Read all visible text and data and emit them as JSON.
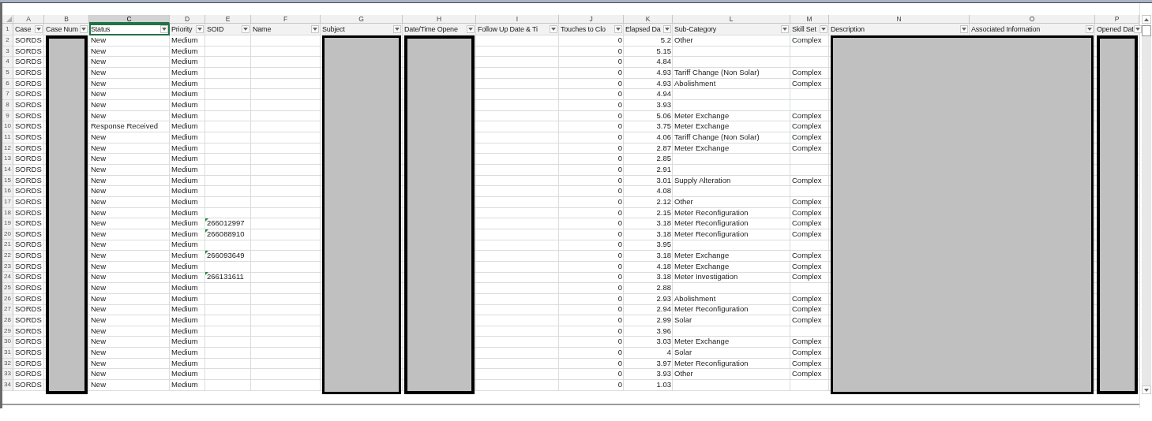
{
  "header_row_number": "1",
  "columns": [
    {
      "letter": "A",
      "header": "Case",
      "selected": false,
      "redacted": false
    },
    {
      "letter": "B",
      "header": "Case Num",
      "selected": false,
      "redacted": true
    },
    {
      "letter": "C",
      "header": "Status",
      "selected": true,
      "redacted": false
    },
    {
      "letter": "D",
      "header": "Priority",
      "selected": false,
      "redacted": false
    },
    {
      "letter": "E",
      "header": "SOID",
      "selected": false,
      "redacted": false
    },
    {
      "letter": "F",
      "header": "Name",
      "selected": false,
      "redacted": false
    },
    {
      "letter": "G",
      "header": "Subject",
      "selected": false,
      "redacted": true
    },
    {
      "letter": "H",
      "header": "Date/Time Opene",
      "selected": false,
      "redacted": true
    },
    {
      "letter": "I",
      "header": "Follow Up Date & Ti",
      "selected": false,
      "redacted": false
    },
    {
      "letter": "J",
      "header": "Touches to Clo",
      "selected": false,
      "redacted": false
    },
    {
      "letter": "K",
      "header": "Elapsed Da",
      "selected": false,
      "redacted": false
    },
    {
      "letter": "L",
      "header": "Sub-Category",
      "selected": false,
      "redacted": false
    },
    {
      "letter": "M",
      "header": "Skill Set",
      "selected": false,
      "redacted": false
    },
    {
      "letter": "N",
      "header": "Description",
      "selected": false,
      "redacted": true,
      "merged_with_next": true
    },
    {
      "letter": "O",
      "header": "Associated Information",
      "selected": false,
      "redacted": true
    },
    {
      "letter": "P",
      "header": "Opened Dat",
      "selected": false,
      "redacted": true
    }
  ],
  "rows": [
    {
      "number": "2",
      "case": "SORDS",
      "status": "New",
      "priority": "Medium",
      "soid_flag": false,
      "touches": "0",
      "elapsed": "5.2",
      "sub_category": "Other",
      "skill_set": "Complex"
    },
    {
      "number": "3",
      "case": "SORDS",
      "status": "New",
      "priority": "Medium",
      "soid_flag": false,
      "touches": "0",
      "elapsed": "5.15"
    },
    {
      "number": "4",
      "case": "SORDS",
      "status": "New",
      "priority": "Medium",
      "soid_flag": false,
      "touches": "0",
      "elapsed": "4.84"
    },
    {
      "number": "5",
      "case": "SORDS",
      "status": "New",
      "priority": "Medium",
      "soid_flag": false,
      "touches": "0",
      "elapsed": "4.93",
      "sub_category": "Tariff Change (Non Solar)",
      "skill_set": "Complex"
    },
    {
      "number": "6",
      "case": "SORDS",
      "status": "New",
      "priority": "Medium",
      "soid_flag": false,
      "touches": "0",
      "elapsed": "4.93",
      "sub_category": "Abolishment",
      "skill_set": "Complex"
    },
    {
      "number": "7",
      "case": "SORDS",
      "status": "New",
      "priority": "Medium",
      "soid_flag": false,
      "touches": "0",
      "elapsed": "4.94"
    },
    {
      "number": "8",
      "case": "SORDS",
      "status": "New",
      "priority": "Medium",
      "soid_flag": false,
      "touches": "0",
      "elapsed": "3.93"
    },
    {
      "number": "9",
      "case": "SORDS",
      "status": "New",
      "priority": "Medium",
      "soid_flag": false,
      "touches": "0",
      "elapsed": "5.06",
      "sub_category": "Meter Exchange",
      "skill_set": "Complex"
    },
    {
      "number": "10",
      "case": "SORDS",
      "status": "Response Received",
      "priority": "Medium",
      "soid_flag": false,
      "touches": "0",
      "elapsed": "3.75",
      "sub_category": "Meter Exchange",
      "skill_set": "Complex"
    },
    {
      "number": "11",
      "case": "SORDS",
      "status": "New",
      "priority": "Medium",
      "soid_flag": false,
      "touches": "0",
      "elapsed": "4.06",
      "sub_category": "Tariff Change (Non Solar)",
      "skill_set": "Complex"
    },
    {
      "number": "12",
      "case": "SORDS",
      "status": "New",
      "priority": "Medium",
      "soid_flag": false,
      "touches": "0",
      "elapsed": "2.87",
      "sub_category": "Meter Exchange",
      "skill_set": "Complex"
    },
    {
      "number": "13",
      "case": "SORDS",
      "status": "New",
      "priority": "Medium",
      "soid_flag": false,
      "touches": "0",
      "elapsed": "2.85"
    },
    {
      "number": "14",
      "case": "SORDS",
      "status": "New",
      "priority": "Medium",
      "soid_flag": false,
      "touches": "0",
      "elapsed": "2.91"
    },
    {
      "number": "15",
      "case": "SORDS",
      "status": "New",
      "priority": "Medium",
      "soid_flag": false,
      "touches": "0",
      "elapsed": "3.01",
      "sub_category": "Supply Alteration",
      "skill_set": "Complex"
    },
    {
      "number": "16",
      "case": "SORDS",
      "status": "New",
      "priority": "Medium",
      "soid_flag": false,
      "touches": "0",
      "elapsed": "4.08"
    },
    {
      "number": "17",
      "case": "SORDS",
      "status": "New",
      "priority": "Medium",
      "soid_flag": false,
      "touches": "0",
      "elapsed": "2.12",
      "sub_category": "Other",
      "skill_set": "Complex"
    },
    {
      "number": "18",
      "case": "SORDS",
      "status": "New",
      "priority": "Medium",
      "soid_flag": false,
      "touches": "0",
      "elapsed": "2.15",
      "sub_category": "Meter Reconfiguration",
      "skill_set": "Complex"
    },
    {
      "number": "19",
      "case": "SORDS",
      "status": "New",
      "priority": "Medium",
      "soid": "266012997",
      "soid_flag": true,
      "touches": "0",
      "elapsed": "3.18",
      "sub_category": "Meter Reconfiguration",
      "skill_set": "Complex"
    },
    {
      "number": "20",
      "case": "SORDS",
      "status": "New",
      "priority": "Medium",
      "soid": "266088910",
      "soid_flag": true,
      "touches": "0",
      "elapsed": "3.18",
      "sub_category": "Meter Reconfiguration",
      "skill_set": "Complex"
    },
    {
      "number": "21",
      "case": "SORDS",
      "status": "New",
      "priority": "Medium",
      "soid_flag": false,
      "touches": "0",
      "elapsed": "3.95"
    },
    {
      "number": "22",
      "case": "SORDS",
      "status": "New",
      "priority": "Medium",
      "soid": "266093649",
      "soid_flag": true,
      "touches": "0",
      "elapsed": "3.18",
      "sub_category": "Meter Exchange",
      "skill_set": "Complex"
    },
    {
      "number": "23",
      "case": "SORDS",
      "status": "New",
      "priority": "Medium",
      "soid_flag": false,
      "touches": "0",
      "elapsed": "4.18",
      "sub_category": "Meter Exchange",
      "skill_set": "Complex"
    },
    {
      "number": "24",
      "case": "SORDS",
      "status": "New",
      "priority": "Medium",
      "soid": "266131611",
      "soid_flag": true,
      "touches": "0",
      "elapsed": "3.18",
      "sub_category": "Meter Investigation",
      "skill_set": "Complex"
    },
    {
      "number": "25",
      "case": "SORDS",
      "status": "New",
      "priority": "Medium",
      "soid_flag": false,
      "touches": "0",
      "elapsed": "2.88"
    },
    {
      "number": "26",
      "case": "SORDS",
      "status": "New",
      "priority": "Medium",
      "soid_flag": false,
      "touches": "0",
      "elapsed": "2.93",
      "sub_category": "Abolishment",
      "skill_set": "Complex"
    },
    {
      "number": "27",
      "case": "SORDS",
      "status": "New",
      "priority": "Medium",
      "soid_flag": false,
      "touches": "0",
      "elapsed": "2.94",
      "sub_category": "Meter Reconfiguration",
      "skill_set": "Complex"
    },
    {
      "number": "28",
      "case": "SORDS",
      "status": "New",
      "priority": "Medium",
      "soid_flag": false,
      "touches": "0",
      "elapsed": "2.99",
      "sub_category": "Solar",
      "skill_set": "Complex"
    },
    {
      "number": "29",
      "case": "SORDS",
      "status": "New",
      "priority": "Medium",
      "soid_flag": false,
      "touches": "0",
      "elapsed": "3.96"
    },
    {
      "number": "30",
      "case": "SORDS",
      "status": "New",
      "priority": "Medium",
      "soid_flag": false,
      "touches": "0",
      "elapsed": "3.03",
      "sub_category": "Meter Exchange",
      "skill_set": "Complex"
    },
    {
      "number": "31",
      "case": "SORDS",
      "status": "New",
      "priority": "Medium",
      "soid_flag": false,
      "touches": "0",
      "elapsed": "4",
      "sub_category": "Solar",
      "skill_set": "Complex"
    },
    {
      "number": "32",
      "case": "SORDS",
      "status": "New",
      "priority": "Medium",
      "soid_flag": false,
      "touches": "0",
      "elapsed": "3.97",
      "sub_category": "Meter Reconfiguration",
      "skill_set": "Complex"
    },
    {
      "number": "33",
      "case": "SORDS",
      "status": "New",
      "priority": "Medium",
      "soid_flag": false,
      "touches": "0",
      "elapsed": "3.93",
      "sub_category": "Other",
      "skill_set": "Complex"
    },
    {
      "number": "34",
      "case": "SORDS",
      "status": "New",
      "priority": "Medium",
      "soid_flag": false,
      "touches": "0",
      "elapsed": "1.03"
    }
  ]
}
